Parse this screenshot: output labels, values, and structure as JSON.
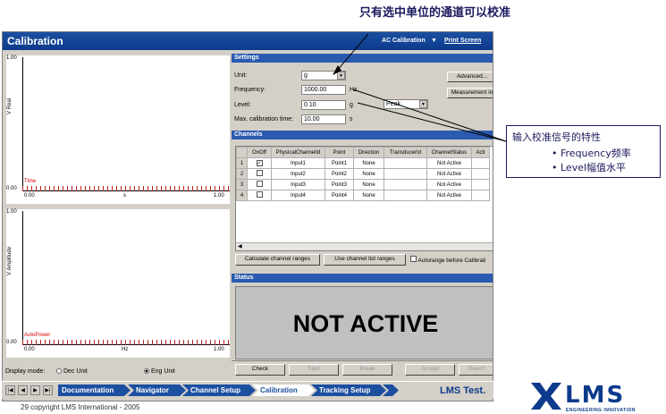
{
  "annotations": {
    "top_note": "只有选中单位的通道可以校准",
    "box_title": "输入校准信号的特性",
    "box_items": [
      "Frequency频率",
      "Level幅值水平"
    ]
  },
  "window": {
    "title": "Calibration",
    "mode_label": "AC Calibration",
    "print_label": "Print Screen"
  },
  "plot_top": {
    "y_ticks": [
      "1.00",
      "0.00"
    ],
    "x_ticks": [
      "0.00",
      "s",
      "1.00"
    ],
    "y_label": "Real",
    "y_axis_unit": "V",
    "trace": "Time"
  },
  "plot_bottom": {
    "y_ticks": [
      "1.00",
      "0.00"
    ],
    "x_ticks": [
      "0.00",
      "Hz",
      "1.00"
    ],
    "y_label": "Amplitude",
    "y_axis_unit": "V",
    "trace": "AutoPower"
  },
  "display_mode": {
    "label": "Display mode:",
    "options": [
      "Dec Unit",
      "Eng Unit"
    ],
    "selected": "Eng Unit"
  },
  "settings": {
    "header": "Settings",
    "unit_label": "Unit:",
    "unit_value": "g",
    "frequency_label": "Frequency:",
    "frequency_value": "1000.00",
    "frequency_unit": "Hz",
    "level_label": "Level:",
    "level_value": "0.10",
    "level_unit": "g",
    "level_type": "Peak",
    "max_time_label": "Max. calibration time:",
    "max_time_value": "10.00",
    "max_time_unit": "s",
    "advanced_button": "Advanced...",
    "measurement_button": "Measurement in"
  },
  "channels": {
    "header": "Channels",
    "columns": [
      "",
      "OnOff",
      "PhysicalChannelId",
      "Point",
      "Direction",
      "TransducerId",
      "ChannelStatus",
      "Acti"
    ],
    "rows": [
      {
        "num": "1",
        "checked": true,
        "id": "Input1",
        "point": "Point1",
        "direction": "None",
        "transducer": "",
        "status": "Not Active"
      },
      {
        "num": "2",
        "checked": false,
        "id": "Input2",
        "point": "Point2",
        "direction": "None",
        "transducer": "",
        "status": "Not Active"
      },
      {
        "num": "3",
        "checked": false,
        "id": "Input3",
        "point": "Point3",
        "direction": "None",
        "transducer": "",
        "status": "Not Active"
      },
      {
        "num": "4",
        "checked": false,
        "id": "Input4",
        "point": "Point4",
        "direction": "None",
        "transducer": "",
        "status": "Not Active"
      }
    ],
    "calc_button": "Calculate channel ranges",
    "use_button": "Use channel list ranges",
    "autorange_label": "Autorange before Calibrati"
  },
  "status": {
    "header": "Status",
    "value": "NOT ACTIVE"
  },
  "actions": {
    "check": "Check",
    "start": "Start",
    "break": "Break",
    "accept": "Accept",
    "reject": "Reject"
  },
  "workflow": {
    "steps": [
      "Documentation",
      "Navigator",
      "Channel Setup",
      "Calibration",
      "Tracking Setup"
    ],
    "active": "Calibration",
    "brand": "LMS Test."
  },
  "footer": {
    "copyright": "29 copyright LMS International - 2005"
  },
  "logo": {
    "name": "LMS",
    "tagline": "ENGINEERING INNOVATION"
  },
  "colors": {
    "header_blue": "#1c4fa0",
    "annotation_navy": "#1a1a5e",
    "trace_red": "#d00000"
  }
}
